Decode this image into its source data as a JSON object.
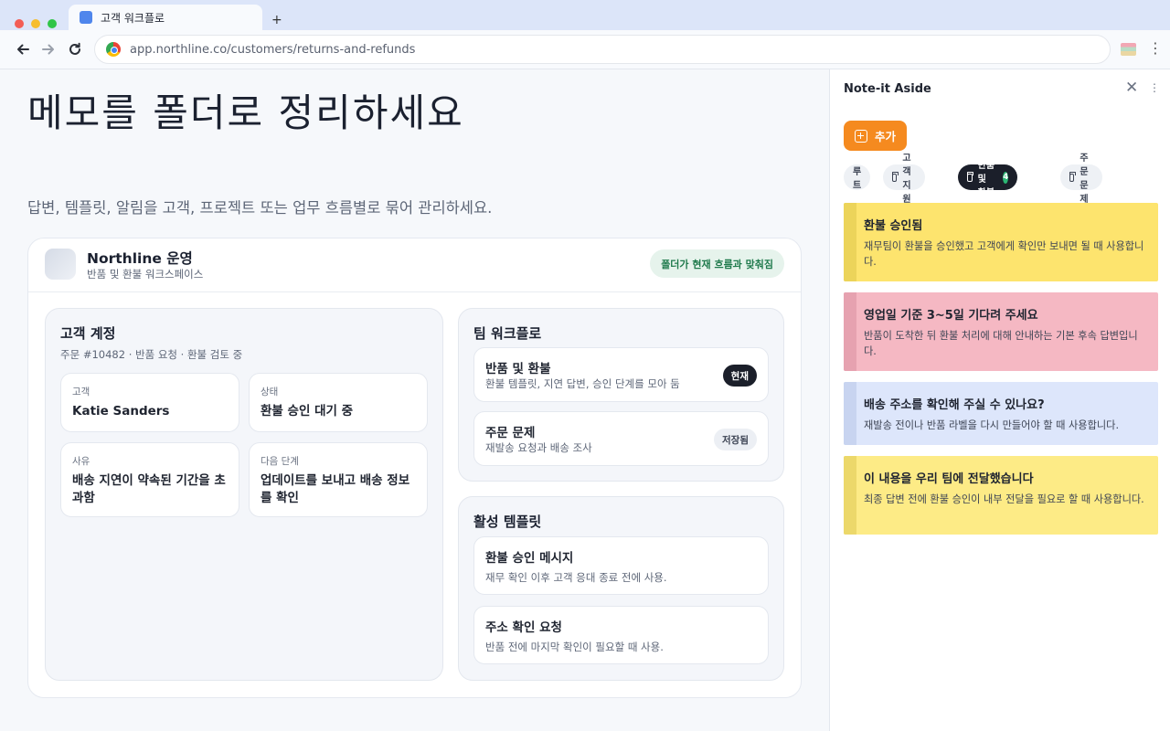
{
  "browser": {
    "tab_title": "고객 워크플로",
    "new_tab_label": "+",
    "url": "app.northline.co/customers/returns-and-refunds",
    "menu_label": "⋮"
  },
  "hero": {
    "title": "메모를 폴더로 정리하세요",
    "subtitle": "답변, 템플릿, 알림을 고객, 프로젝트 또는 업무 흐름별로 묶어 관리하세요."
  },
  "workspace": {
    "name": "Northline 운영",
    "subtitle": "반품 및 환불 워크스페이스",
    "status_badge": "폴더가 현재 흐름과 맞춰짐"
  },
  "account": {
    "title": "고객 계정",
    "meta": "주문 #10482 · 반품 요청 · 환불 검토 중",
    "fields": [
      {
        "label": "고객",
        "value": "Katie Sanders"
      },
      {
        "label": "상태",
        "value": "환불 승인 대기 중"
      },
      {
        "label": "사유",
        "value": "배송 지연이 약속된 기간을 초과함"
      },
      {
        "label": "다음 단계",
        "value": "업데이트를 보내고 배송 정보를 확인"
      }
    ]
  },
  "team_workflow": {
    "title": "팀 워크플로",
    "items": [
      {
        "title": "반품 및 환불",
        "subtitle": "환불 템플릿, 지연 답변, 승인 단계를 모아 둠",
        "badge": "현재"
      },
      {
        "title": "주문 문제",
        "subtitle": "재발송 요청과 배송 조사",
        "badge": "저장됨"
      }
    ]
  },
  "templates": {
    "title": "활성 템플릿",
    "items": [
      {
        "title": "환불 승인 메시지",
        "subtitle": "재무 확인 이후 고객 응대 종료 전에 사용."
      },
      {
        "title": "주소 확인 요청",
        "subtitle": "반품 전에 마지막 확인이 필요할 때 사용."
      }
    ]
  },
  "sidepanel": {
    "title": "Note-it Aside",
    "close_label": "✕",
    "more_label": "⋮",
    "add_label": "추가",
    "folders": [
      {
        "label": "루트"
      },
      {
        "label": "고객 지원"
      },
      {
        "label": "반품 및 환불",
        "count": "4",
        "active": true
      },
      {
        "label": "주문 문제"
      }
    ],
    "notes": [
      {
        "title": "환불 승인됨",
        "body": "재무팀이 환불을 승인했고 고객에게 확인만 보내면 될 때 사용합니다.",
        "color": "#fde46e",
        "bar": "#ecd45a"
      },
      {
        "title": "영업일 기준 3~5일 기다려 주세요",
        "body": "반품이 도착한 뒤 환불 처리에 대해 안내하는 기본 후속 답변입니다.",
        "color": "#f5b8c3",
        "bar": "#e6a2b0"
      },
      {
        "title": "배송 주소를 확인해 주실 수 있나요?",
        "body": "재발송 전이나 반품 라벨을 다시 만들어야 할 때 사용합니다.",
        "color": "#dde6fb",
        "bar": "#c8d4f0"
      },
      {
        "title": "이 내용을 우리 팀에 전달했습니다",
        "body": "최종 답변 전에 환불 승인이 내부 전달을 필요로 할 때 사용합니다.",
        "color": "#fdeb86",
        "bar": "#ecd86a"
      }
    ]
  }
}
